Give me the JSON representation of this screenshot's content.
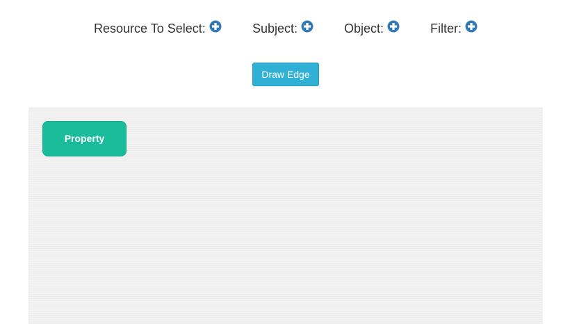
{
  "toolbar": {
    "fields": [
      {
        "label": "Resource To Select:",
        "icon": "plus-circle-icon"
      },
      {
        "label": "Subject:",
        "icon": "plus-circle-icon"
      },
      {
        "label": "Object:",
        "icon": "plus-circle-icon"
      },
      {
        "label": "Filter:",
        "icon": "plus-circle-icon"
      }
    ],
    "icon_color": "#337ab7"
  },
  "draw_edge_button": {
    "label": "Draw Edge",
    "color": "#31b0d5"
  },
  "canvas": {
    "nodes": [
      {
        "label": "Property",
        "color": "#1abc9c"
      }
    ]
  }
}
